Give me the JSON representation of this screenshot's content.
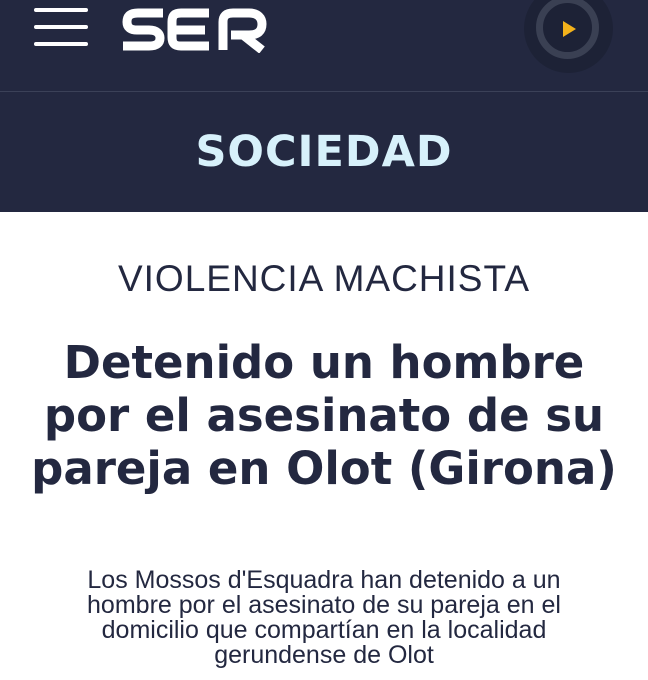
{
  "header": {
    "logo_text": "SER",
    "menu_icon": "hamburger-menu-icon",
    "play_icon": "play-icon",
    "background_color": "#232840",
    "accent_color": "#f3b21b"
  },
  "section": {
    "label": "SOCIEDAD",
    "label_color": "#d7f1fb"
  },
  "article": {
    "kicker": "VIOLENCIA MACHISTA",
    "headline": "Detenido un hombre por el asesinato de su pareja en Olot (Girona)",
    "summary": "Los Mossos d'Esquadra han detenido a un hombre por el asesinato de su pareja en el domicilio que compartían en la localidad gerundense de Olot",
    "text_color": "#232840"
  }
}
